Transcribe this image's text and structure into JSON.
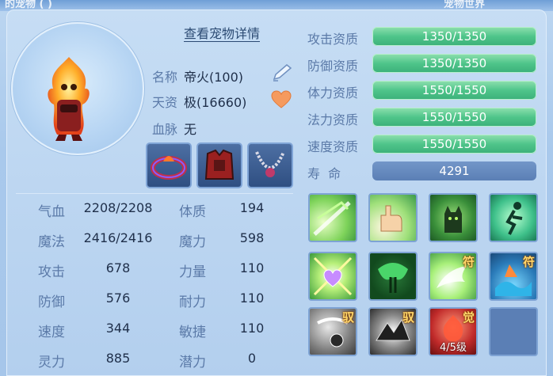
{
  "header": {
    "left_title": "的宠物 (   )",
    "right_title": "宠物世界"
  },
  "view_details_link": "查看宠物详情",
  "info": {
    "name_label": "名称",
    "name_value": "帝火(100)",
    "aptitude_label": "天资",
    "aptitude_value": "极(16660)",
    "bloodline_label": "血脉",
    "bloodline_value": "无"
  },
  "stats": [
    {
      "label": "气血",
      "value": "2208/2208"
    },
    {
      "label": "体质",
      "value": "194"
    },
    {
      "label": "魔法",
      "value": "2416/2416"
    },
    {
      "label": "魔力",
      "value": "598"
    },
    {
      "label": "攻击",
      "value": "678"
    },
    {
      "label": "力量",
      "value": "110"
    },
    {
      "label": "防御",
      "value": "576"
    },
    {
      "label": "耐力",
      "value": "110"
    },
    {
      "label": "速度",
      "value": "344"
    },
    {
      "label": "敏捷",
      "value": "110"
    },
    {
      "label": "灵力",
      "value": "885"
    },
    {
      "label": "潜力",
      "value": "0"
    }
  ],
  "qualities": [
    {
      "label": "攻击资质",
      "value": "1350/1350",
      "fill": 1
    },
    {
      "label": "防御资质",
      "value": "1350/1350",
      "fill": 1
    },
    {
      "label": "体力资质",
      "value": "1550/1550",
      "fill": 1
    },
    {
      "label": "法力资质",
      "value": "1550/1550",
      "fill": 1
    },
    {
      "label": "速度资质",
      "value": "1550/1550",
      "fill": 1
    }
  ],
  "life": {
    "label": "寿  命",
    "value": "4291"
  },
  "skills": [
    {
      "badge": ""
    },
    {
      "badge": ""
    },
    {
      "badge": ""
    },
    {
      "badge": ""
    },
    {
      "badge": ""
    },
    {
      "badge": ""
    },
    {
      "badge": "符"
    },
    {
      "badge": "符"
    },
    {
      "badge": "驭"
    },
    {
      "badge": "驭"
    },
    {
      "badge": "觉",
      "level": "4/5级"
    },
    {
      "badge": ""
    }
  ],
  "colors": {
    "accent_green": "#4fc58a",
    "label_blue": "#5b7aa8",
    "text_dark": "#1f2f4a"
  }
}
